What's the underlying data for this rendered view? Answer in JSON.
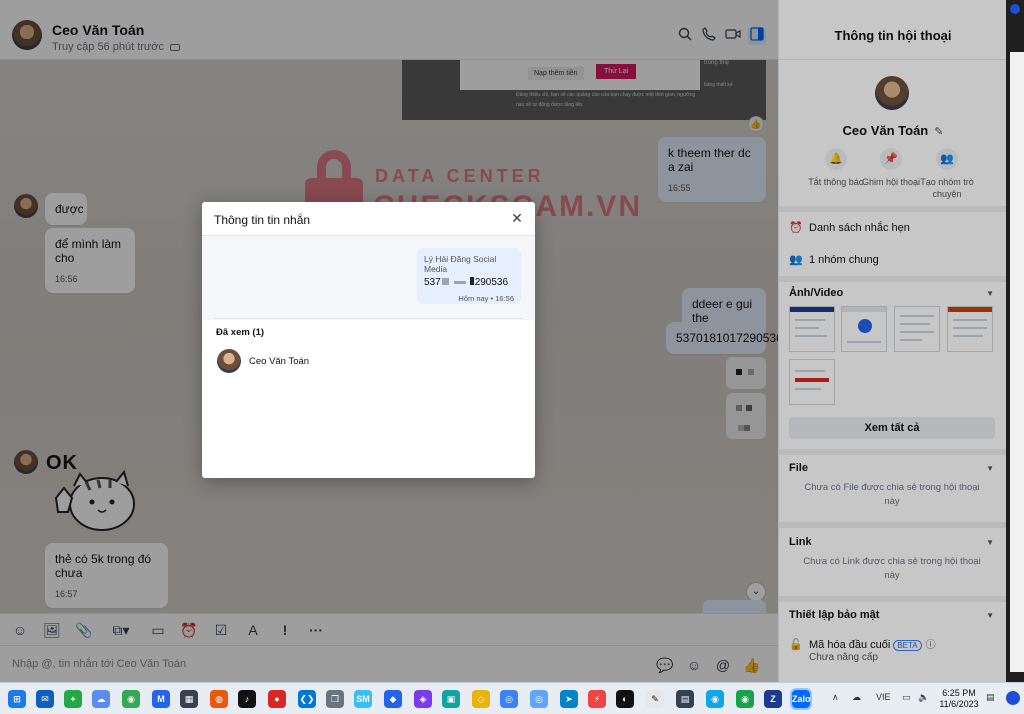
{
  "header": {
    "contact_name": "Ceo Văn Toán",
    "last_seen": "Truy cập 56 phút trước"
  },
  "colors": {
    "accent": "#0068ff",
    "my_bubble": "#e5efff",
    "watermark": "#e0314b",
    "retry_button": "#d81b60"
  },
  "messages": {
    "top_notice_btn1": "Nạp thêm tiền",
    "top_notice_btn2": "Thử Lại",
    "top_notice_side": "trong thiệ",
    "top_notice_line1": "bảng thiết kế",
    "top_notice_line2": "Đăng thiệu chi, bạn sẽ các quảng cáo của bạn chạy được một thời gian, ngưỡng",
    "top_notice_line3": "nào sẽ tự động được tăng lên.",
    "m1_text": "k theem ther dc a zai",
    "m1_time": "16:55",
    "m2_text": "được",
    "m3_text": "để mình làm cho",
    "m3_time": "16:56",
    "m4_text": "ddeer e gui the",
    "m5_text": "5370181017290536",
    "m6_text": "thẻ có 5k trong đó chưa",
    "m6_time": "16:57",
    "sticker_text": "OK"
  },
  "watermark": {
    "line1": "DATA CENTER",
    "line2": "CHECKSCAM.VN"
  },
  "composer": {
    "placeholder": "Nhập @, tin nhắn tới Ceo Văn Toán"
  },
  "right_panel": {
    "title": "Thông tin hội thoại",
    "name": "Ceo Văn Toán",
    "actions": [
      {
        "label": "Tắt thông báo"
      },
      {
        "label": "Ghim hội thoại"
      },
      {
        "label": "Tạo nhóm trò chuyện"
      }
    ],
    "reminders": "Danh sách nhắc hẹn",
    "common_groups": "1 nhóm chung",
    "media_title": "Ảnh/Video",
    "see_all": "Xem tất cả",
    "file_title": "File",
    "file_empty": "Chưa có File được chia sẻ trong hội thoại này",
    "link_title": "Link",
    "link_empty": "Chưa có Link được chia sẻ trong hội thoại này",
    "security_title": "Thiết lập bảo mật",
    "e2e_label": "Mã hóa đầu cuối",
    "e2e_badge": "BETA",
    "e2e_status": "Chưa nâng cấp"
  },
  "modal": {
    "title": "Thông tin tin nhắn",
    "preview_sender": "Lý Hải Đăng Social Media",
    "preview_number_start": "537",
    "preview_number_end": "290536",
    "preview_time": "Hôm nay • 16:56",
    "seen_label": "Đã xem (1)",
    "seen_user": "Ceo Văn Toán"
  },
  "taskbar": {
    "language": "VIE",
    "time": "6:25 PM",
    "date": "11/6/2023"
  }
}
